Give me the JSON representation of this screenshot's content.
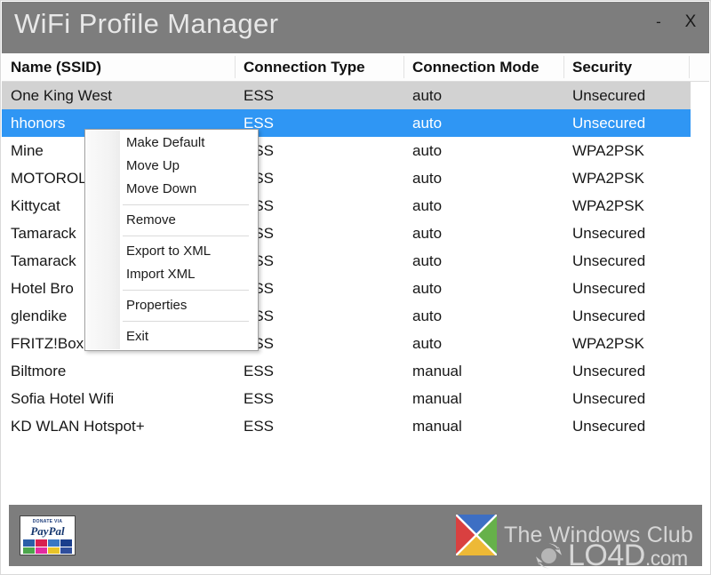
{
  "window": {
    "title": "WiFi Profile Manager",
    "minimize_label": "-",
    "close_label": "X",
    "titlebar_color": "#7d7d7d",
    "accent_color": "#2f96f4"
  },
  "table": {
    "columns": [
      {
        "label": "Name (SSID)"
      },
      {
        "label": "Connection Type"
      },
      {
        "label": "Connection Mode"
      },
      {
        "label": "Security"
      }
    ],
    "rows": [
      {
        "name": "One King West",
        "type": "ESS",
        "mode": "auto",
        "security": "Unsecured",
        "state": "alt"
      },
      {
        "name": "hhonors",
        "type": "ESS",
        "mode": "auto",
        "security": "Unsecured",
        "state": "selected"
      },
      {
        "name": "Mine",
        "type": "ESS",
        "mode": "auto",
        "security": "WPA2PSK",
        "state": "normal"
      },
      {
        "name": "MOTOROLA",
        "type": "ESS",
        "mode": "auto",
        "security": "WPA2PSK",
        "state": "normal"
      },
      {
        "name": "Kittycat",
        "type": "ESS",
        "mode": "auto",
        "security": "WPA2PSK",
        "state": "normal"
      },
      {
        "name": "Tamarack",
        "type": "ESS",
        "mode": "auto",
        "security": "Unsecured",
        "state": "normal"
      },
      {
        "name": "Tamarack",
        "type": "ESS",
        "mode": "auto",
        "security": "Unsecured",
        "state": "normal"
      },
      {
        "name": "Hotel Bro",
        "type": "ESS",
        "mode": "auto",
        "security": "Unsecured",
        "state": "normal"
      },
      {
        "name": "glendike",
        "type": "ESS",
        "mode": "auto",
        "security": "Unsecured",
        "state": "normal"
      },
      {
        "name": "FRITZ!Box",
        "type": "ESS",
        "mode": "auto",
        "security": "WPA2PSK",
        "state": "normal"
      },
      {
        "name": "Biltmore",
        "type": "ESS",
        "mode": "manual",
        "security": "Unsecured",
        "state": "normal"
      },
      {
        "name": "Sofia Hotel Wifi",
        "type": "ESS",
        "mode": "manual",
        "security": "Unsecured",
        "state": "normal"
      },
      {
        "name": "KD WLAN Hotspot+",
        "type": "ESS",
        "mode": "manual",
        "security": "Unsecured",
        "state": "normal"
      }
    ]
  },
  "context_menu": {
    "items": [
      {
        "label": "Make Default",
        "type": "item"
      },
      {
        "label": "Move Up",
        "type": "item"
      },
      {
        "label": "Move Down",
        "type": "item"
      },
      {
        "type": "separator"
      },
      {
        "label": "Remove",
        "type": "item"
      },
      {
        "type": "separator"
      },
      {
        "label": "Export to XML",
        "type": "item"
      },
      {
        "label": "Import XML",
        "type": "item"
      },
      {
        "type": "separator"
      },
      {
        "label": "Properties",
        "type": "item"
      },
      {
        "type": "separator"
      },
      {
        "label": "Exit",
        "type": "item"
      }
    ]
  },
  "footer": {
    "paypal": {
      "donate_label": "DONATE VIA",
      "brand_label": "PayPal"
    },
    "brand_label": "The Windows Club"
  },
  "watermark": {
    "name": "LO4D",
    "suffix": ".com"
  }
}
